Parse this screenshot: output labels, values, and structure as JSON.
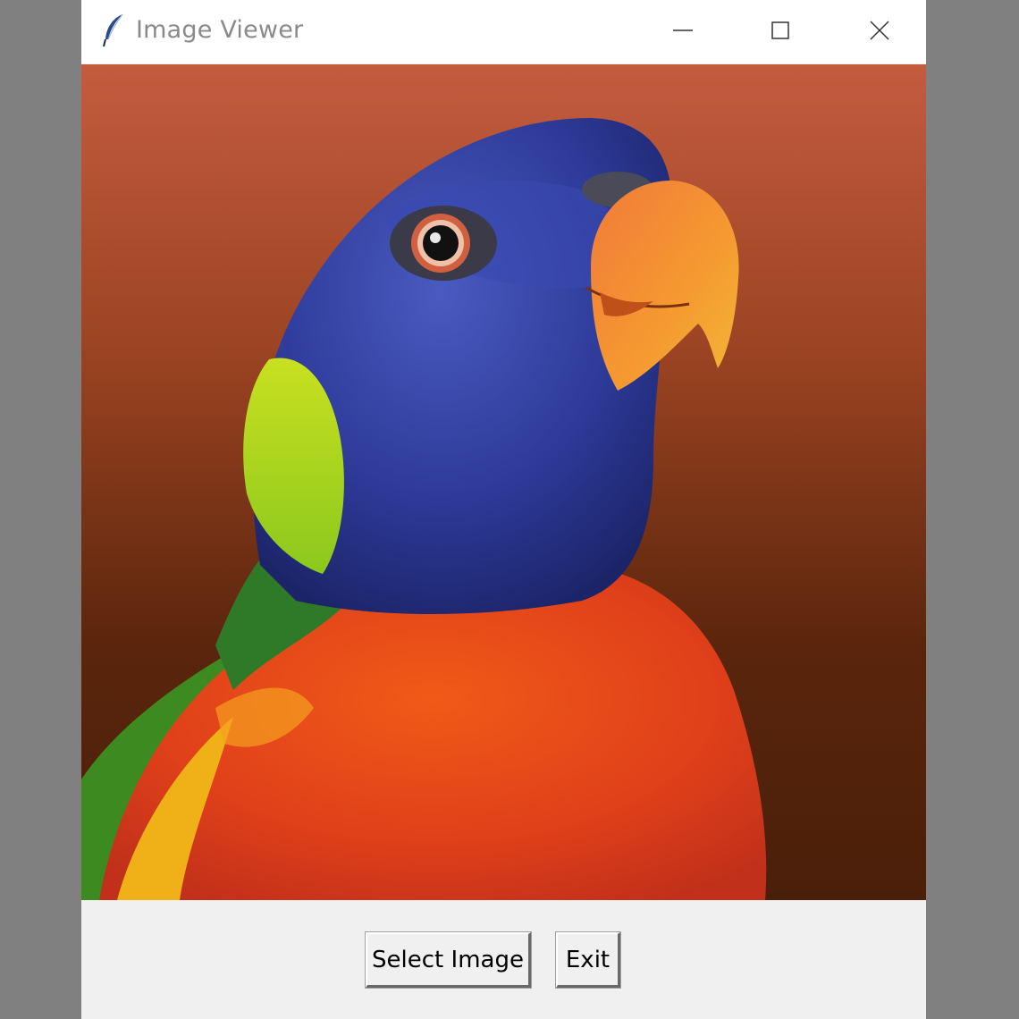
{
  "window": {
    "title": "Image Viewer",
    "icon": "feather-icon",
    "controls": [
      "minimize-icon",
      "maximize-icon",
      "close-icon"
    ]
  },
  "image": {
    "subject": "rainbow-lorikeet-photo",
    "background_color": "#8a3a1c"
  },
  "buttons": {
    "select_label": "Select Image",
    "exit_label": "Exit"
  },
  "colors": {
    "titlebar": "#ffffff",
    "window_bg": "#f0f0f0",
    "desktop": "#808080"
  }
}
